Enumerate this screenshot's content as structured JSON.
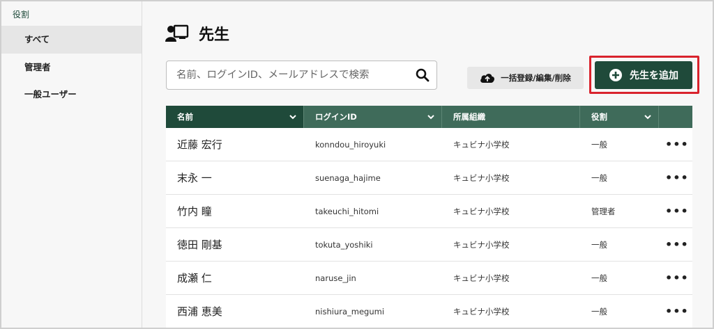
{
  "sidebar": {
    "heading": "役割",
    "items": [
      {
        "label": "すべて",
        "active": true
      },
      {
        "label": "管理者",
        "active": false
      },
      {
        "label": "一般ユーザー",
        "active": false
      }
    ]
  },
  "page": {
    "title": "先生",
    "title_icon": "teacher-board-icon"
  },
  "search": {
    "placeholder": "名前、ログインID、メールアドレスで検索",
    "value": ""
  },
  "toolbar": {
    "bulk_label": "一括登録/編集/削除",
    "add_label": "先生を追加"
  },
  "colors": {
    "accent": "#1f4a3a",
    "header": "#3f6b5a",
    "highlight": "#d9232d"
  },
  "table": {
    "columns": [
      {
        "label": "名前",
        "sortable": true
      },
      {
        "label": "ログインID",
        "sortable": true
      },
      {
        "label": "所属組織",
        "sortable": false
      },
      {
        "label": "役割",
        "sortable": true
      },
      {
        "label": "",
        "sortable": false
      }
    ],
    "rows": [
      {
        "name": "近藤 宏行",
        "login_id": "konndou_hiroyuki",
        "org": "キュビナ小学校",
        "role": "一般",
        "more": "•••"
      },
      {
        "name": "末永 一",
        "login_id": "suenaga_hajime",
        "org": "キュビナ小学校",
        "role": "一般",
        "more": "•••"
      },
      {
        "name": "竹内 瞳",
        "login_id": "takeuchi_hitomi",
        "org": "キュビナ小学校",
        "role": "管理者",
        "more": "•••"
      },
      {
        "name": "徳田 剛基",
        "login_id": "tokuta_yoshiki",
        "org": "キュビナ小学校",
        "role": "一般",
        "more": "•••"
      },
      {
        "name": "成瀬 仁",
        "login_id": "naruse_jin",
        "org": "キュビナ小学校",
        "role": "一般",
        "more": "•••"
      },
      {
        "name": "西浦 恵美",
        "login_id": "nishiura_megumi",
        "org": "キュビナ小学校",
        "role": "一般",
        "more": "•••"
      }
    ]
  }
}
